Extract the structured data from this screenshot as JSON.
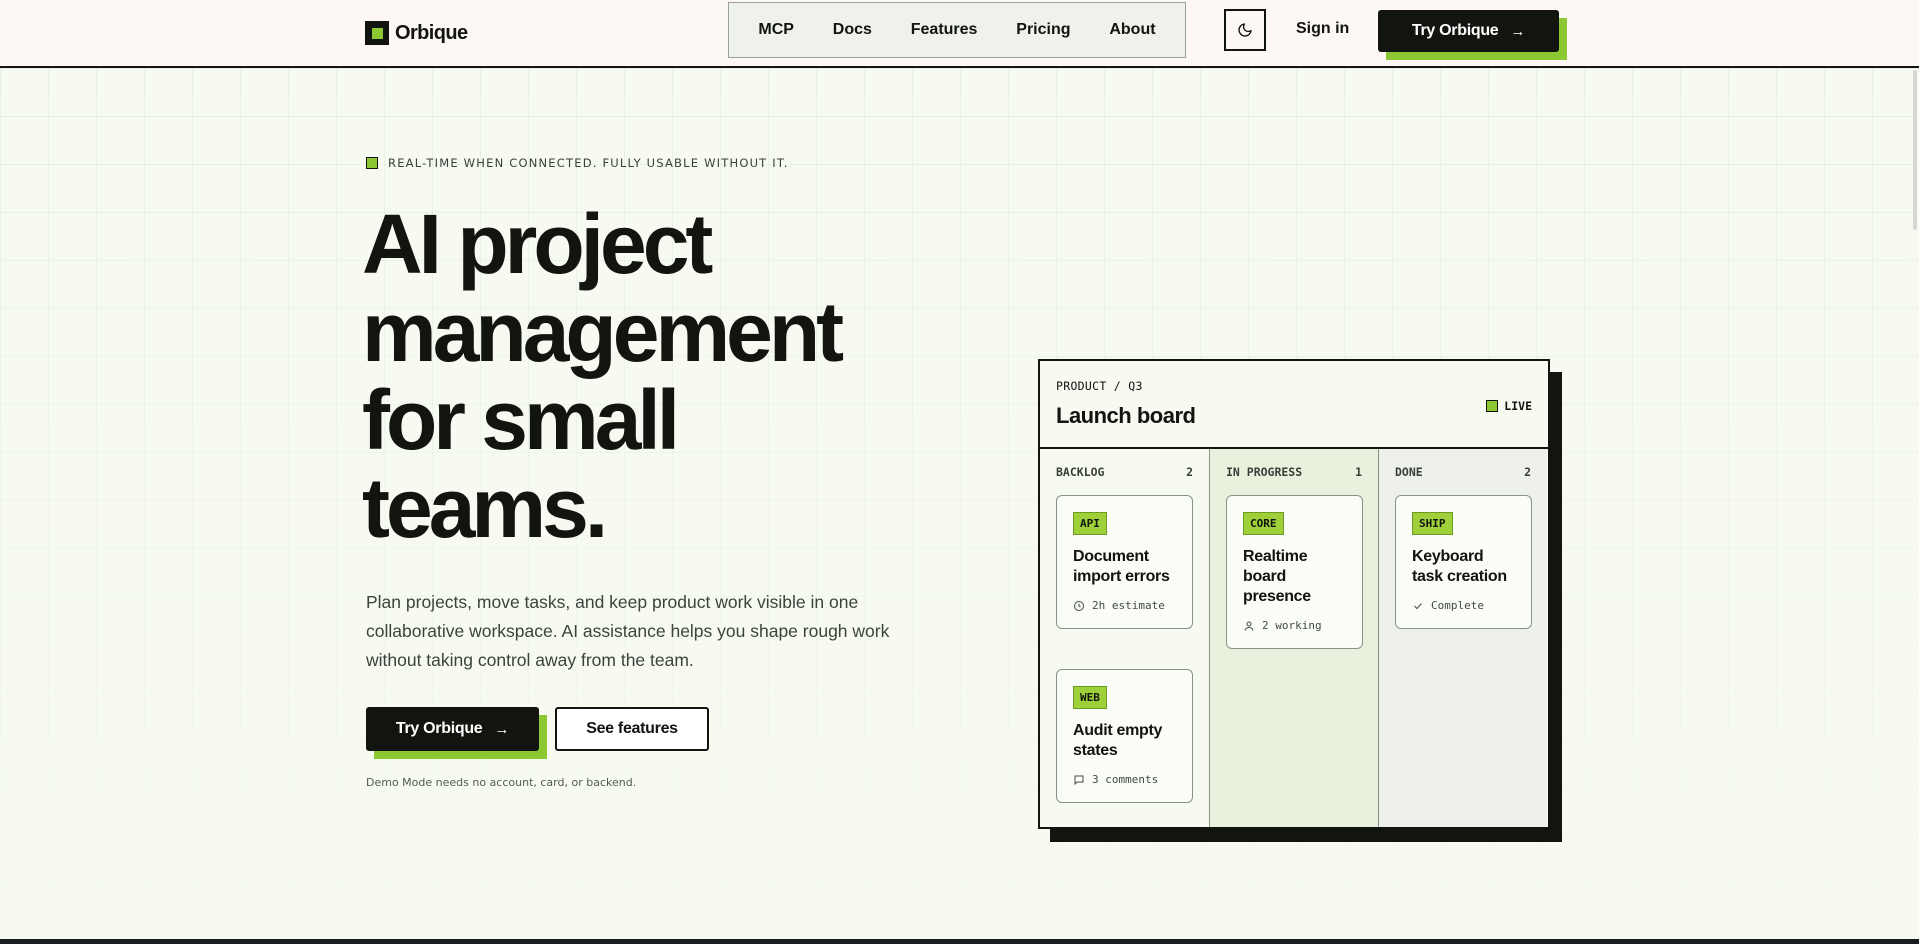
{
  "brand": {
    "name": "Orbique"
  },
  "nav": {
    "items": [
      "MCP",
      "Docs",
      "Features",
      "Pricing",
      "About"
    ]
  },
  "header": {
    "sign_in": "Sign in",
    "try_label": "Try Orbique",
    "theme_icon": "moon-icon"
  },
  "hero": {
    "eyebrow": "REAL-TIME WHEN CONNECTED. FULLY USABLE WITHOUT IT.",
    "title_lines": [
      "AI project",
      "management",
      "for small",
      "teams."
    ],
    "subtitle": "Plan projects, move tasks, and keep product work visible in one collaborative workspace. AI assistance helps you shape rough work without taking control away from the team.",
    "primary_cta": "Try Orbique",
    "secondary_cta": "See features",
    "note": "Demo Mode needs no account, card, or backend."
  },
  "board": {
    "breadcrumb": "PRODUCT / Q3",
    "title": "Launch board",
    "status": "LIVE",
    "columns": [
      {
        "name": "BACKLOG",
        "count": "2",
        "cards": [
          {
            "tag": "API",
            "title": "Document import errors",
            "meta": "2h estimate",
            "icon": "clock-icon"
          },
          {
            "tag": "WEB",
            "title": "Audit empty states",
            "meta": "3 comments",
            "icon": "comment-icon"
          }
        ]
      },
      {
        "name": "IN PROGRESS",
        "count": "1",
        "cards": [
          {
            "tag": "CORE",
            "title": "Realtime board presence",
            "meta": "2 working",
            "icon": "person-icon"
          }
        ]
      },
      {
        "name": "DONE",
        "count": "2",
        "cards": [
          {
            "tag": "SHIP",
            "title": "Keyboard task creation",
            "meta": "Complete",
            "icon": "check-icon"
          }
        ]
      }
    ]
  },
  "colors": {
    "accent": "#8bc832",
    "ink": "#121410",
    "background": "#f6faf1"
  }
}
